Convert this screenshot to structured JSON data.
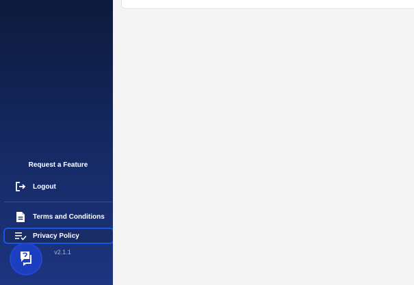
{
  "sidebar": {
    "request_feature": "Request a Feature",
    "logout": {
      "label": "Logout",
      "icon": "logout-icon"
    },
    "terms": {
      "label": "Terms and Conditions",
      "icon": "document-icon"
    },
    "privacy": {
      "label": "Privacy Policy",
      "icon": "list-check-icon"
    },
    "version": "v2.1.1"
  },
  "help_button": {
    "icon": "help-chat-icon"
  },
  "colors": {
    "sidebar_top": "#0d1a3c",
    "sidebar_bottom": "#1d3580",
    "accent": "#1a55e6",
    "main_bg": "#f4f4f4"
  }
}
